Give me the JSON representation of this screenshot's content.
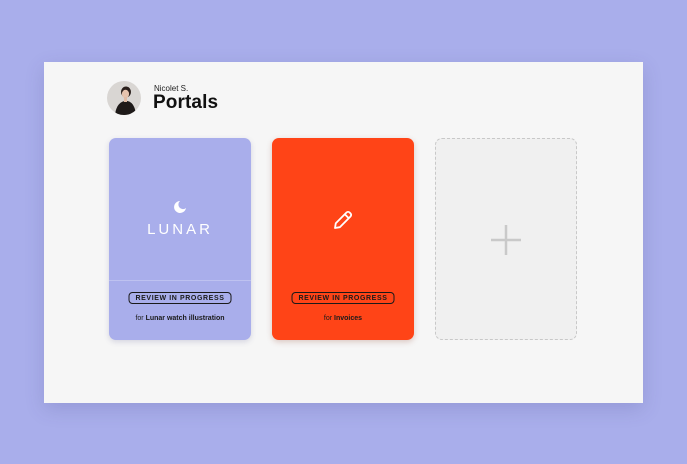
{
  "user": {
    "name": "Nicolet S."
  },
  "page": {
    "title": "Portals"
  },
  "portals": [
    {
      "logo_text": "LUNAR",
      "logo_icon": "moon-icon",
      "status": "REVIEW IN PROGRESS",
      "caption_prefix": "for",
      "caption_name": "Lunar watch illustration",
      "color": "#a9aeeb"
    },
    {
      "icon": "pencil-icon",
      "status": "REVIEW IN PROGRESS",
      "caption_prefix": "for",
      "caption_name": "Invoices",
      "color": "#ff4417"
    }
  ],
  "add_portal": {
    "icon": "plus-icon"
  },
  "colors": {
    "background": "#a9aeeb",
    "panel": "#f6f6f6",
    "accent_orange": "#ff4417",
    "accent_lavender": "#a9aeeb"
  }
}
